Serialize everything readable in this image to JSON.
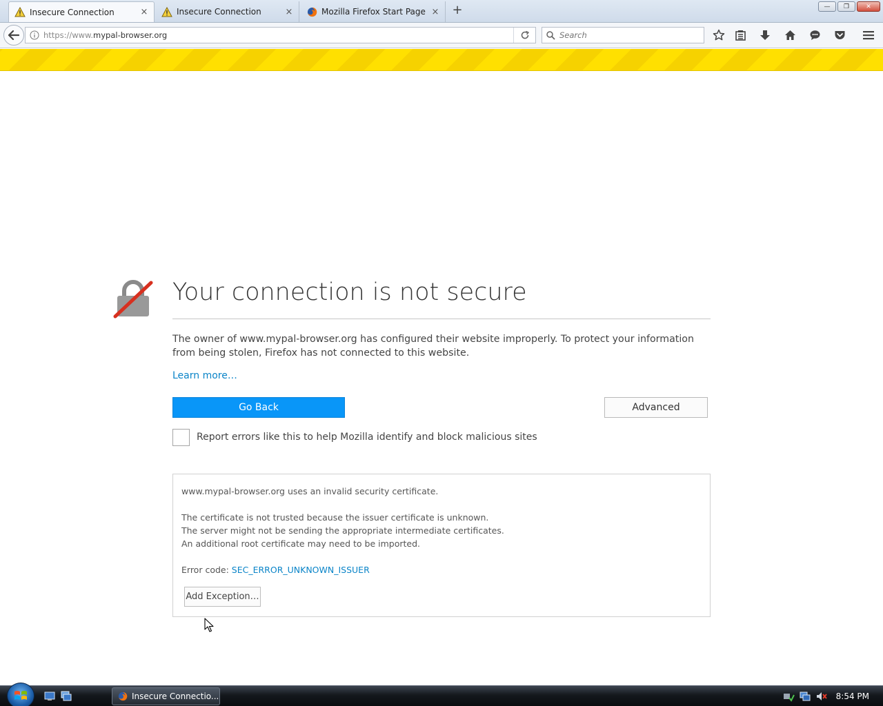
{
  "tabs": [
    {
      "label": "Insecure Connection",
      "icon": "warning-icon",
      "active": true
    },
    {
      "label": "Insecure Connection",
      "icon": "warning-icon",
      "active": false
    },
    {
      "label": "Mozilla Firefox Start Page",
      "icon": "firefox-icon",
      "active": false
    }
  ],
  "tab_close_glyph": "×",
  "new_tab_glyph": "+",
  "window_buttons": {
    "minimize": "—",
    "restore": "❐",
    "close": "✕"
  },
  "urlbar": {
    "scheme": "https://www.",
    "domain": "mypal-browser.org"
  },
  "search": {
    "placeholder": "Search"
  },
  "toolbar_icons": [
    "star-icon",
    "reading-list-icon",
    "download-icon",
    "home-icon",
    "chat-icon",
    "pocket-icon",
    "menu-icon"
  ],
  "error_page": {
    "title": "Your connection is not secure",
    "description": "The owner of www.mypal-browser.org has configured their website improperly. To protect your information from being stolen, Firefox has not connected to this website.",
    "learn_more": "Learn more…",
    "go_back": "Go Back",
    "advanced": "Advanced",
    "report_label": "Report errors like this to help Mozilla identify and block malicious sites",
    "report_checked": false,
    "advanced_panel": {
      "line1": "www.mypal-browser.org uses an invalid security certificate.",
      "line2": "The certificate is not trusted because the issuer certificate is unknown.",
      "line3": "The server might not be sending the appropriate intermediate certificates.",
      "line4": "An additional root certificate may need to be imported.",
      "error_code_label": "Error code: ",
      "error_code": "SEC_ERROR_UNKNOWN_ISSUER",
      "add_exception": "Add Exception…"
    }
  },
  "taskbar": {
    "task_item": "Insecure Connectio...",
    "clock": "8:54 PM"
  },
  "colors": {
    "accent": "#0996f8",
    "link": "#0a84c8",
    "stripe_yellow": "#ffe000"
  }
}
